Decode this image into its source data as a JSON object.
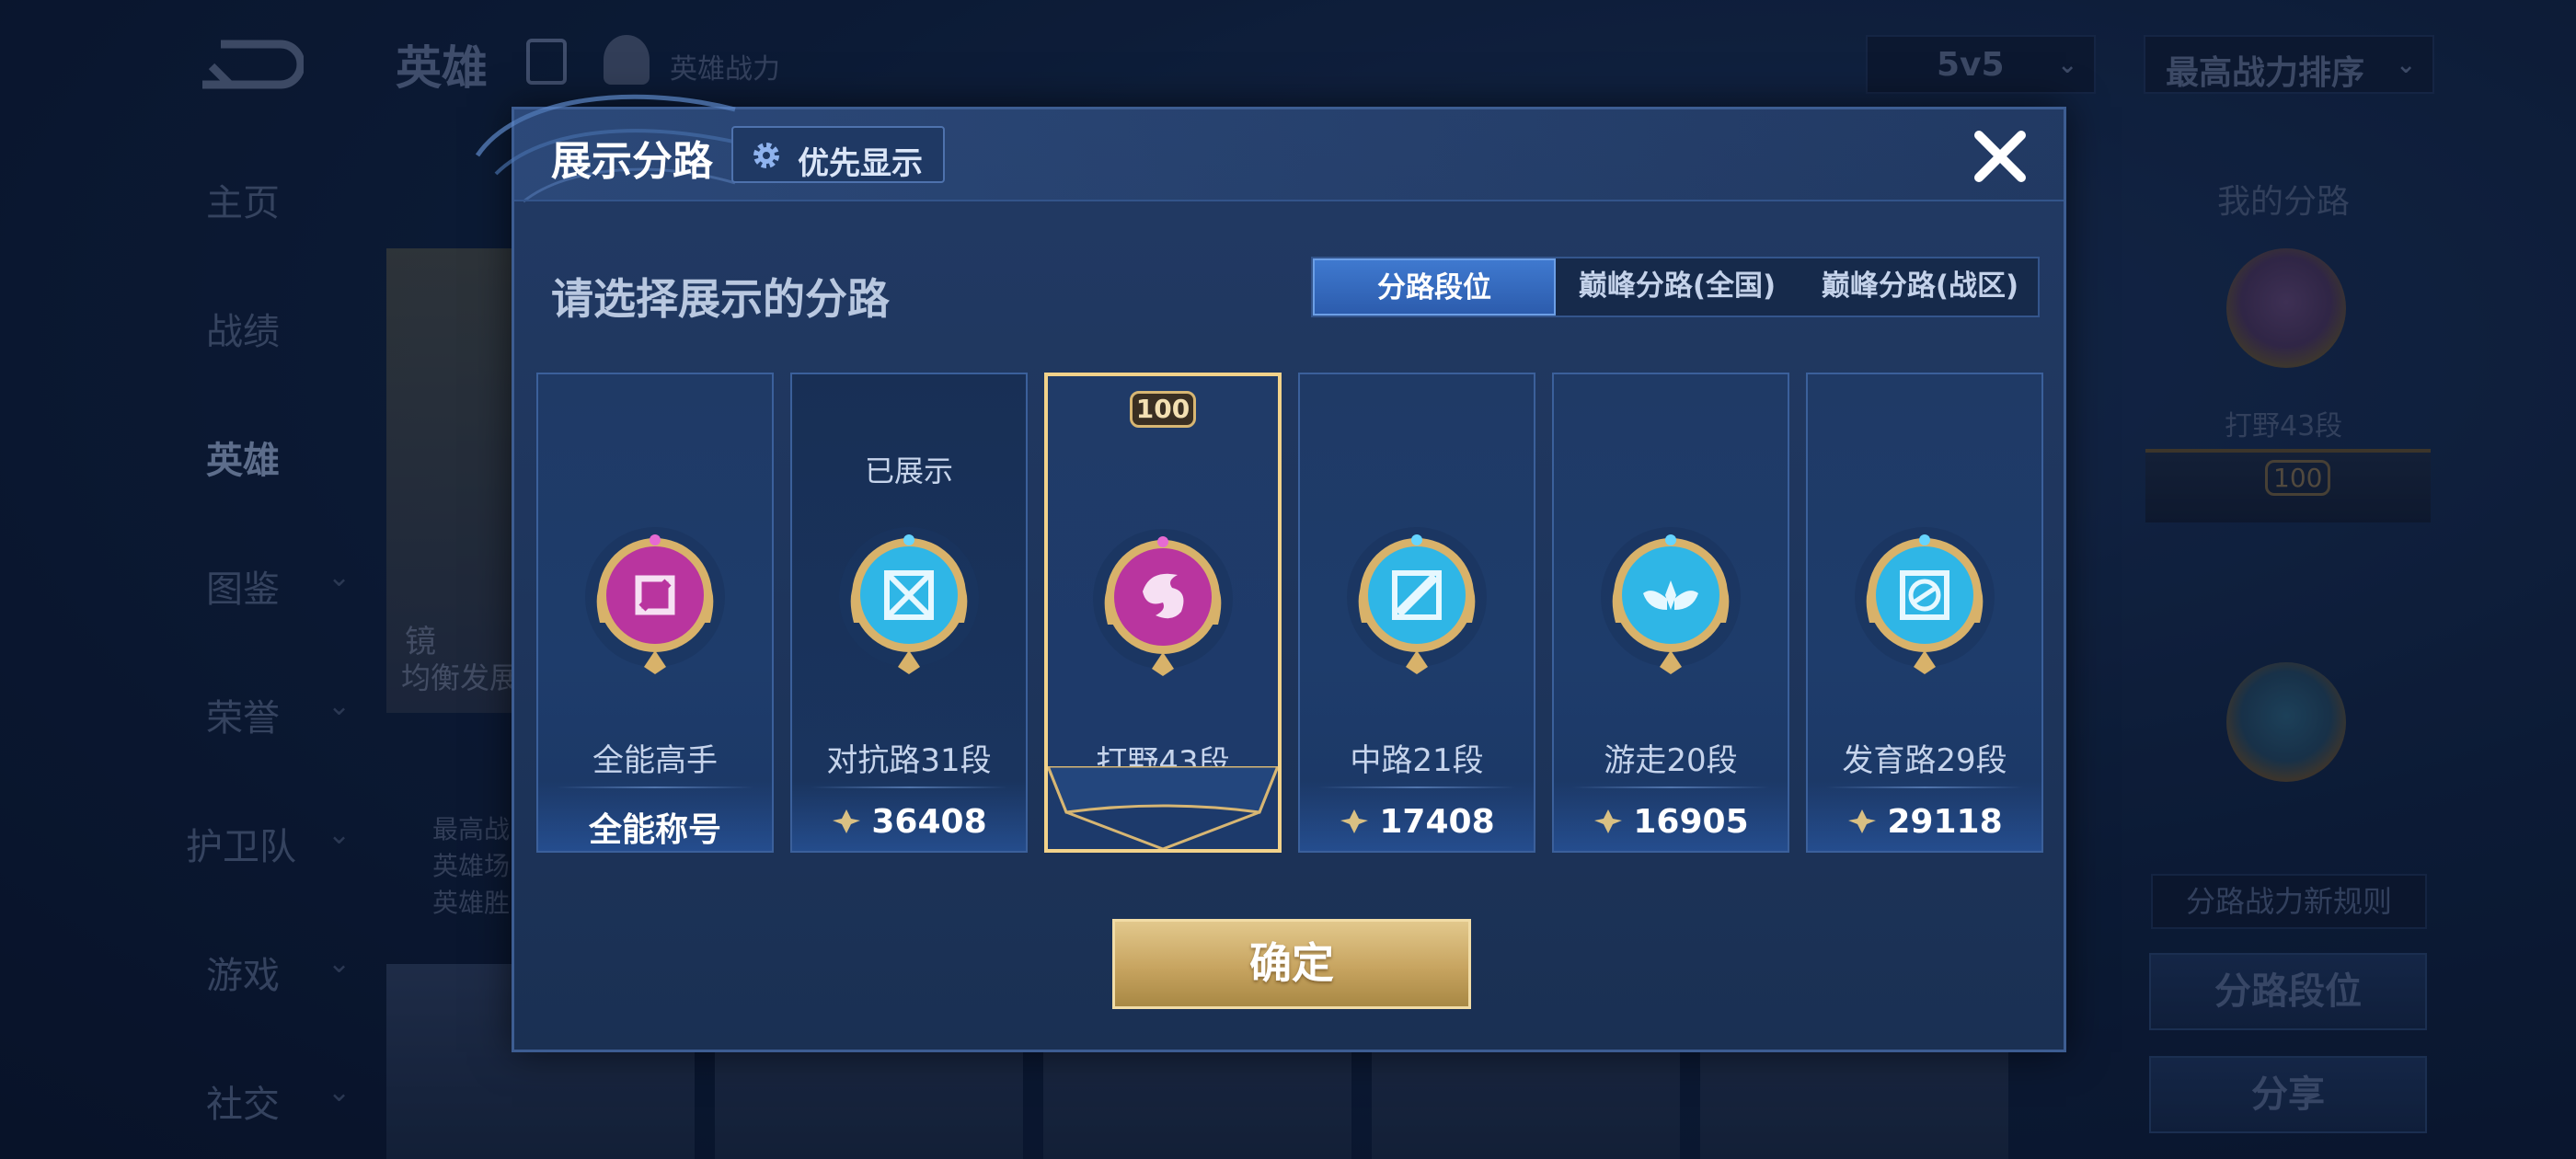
{
  "topbar": {
    "title": "英雄",
    "hero_power_link": "英雄战力",
    "mode_select": "5v5",
    "sort_select": "最高战力排序"
  },
  "sidebar": {
    "items": [
      {
        "label": "主页"
      },
      {
        "label": "战绩"
      },
      {
        "label": "英雄",
        "active": true
      },
      {
        "label": "图鉴"
      },
      {
        "label": "荣誉"
      },
      {
        "label": "护卫队"
      },
      {
        "label": "游戏"
      },
      {
        "label": "社交"
      }
    ]
  },
  "background": {
    "hero_name": "镜",
    "hero_style": "均衡发展",
    "stats": [
      "最高战",
      "英雄场",
      "英雄胜"
    ]
  },
  "right_panel": {
    "title": "我的分路",
    "lane_label": "打野43段",
    "rank_number": "100",
    "rule_label": "分路战力新规则",
    "lane_rank_button": "分路段位",
    "share_button": "分享"
  },
  "dialog": {
    "title": "展示分路",
    "priority_button": "优先显示",
    "select_title": "请选择展示的分路",
    "tabs": [
      "分路段位",
      "巅峰分路(全国)",
      "巅峰分路(战区)"
    ],
    "active_tab": "分路段位",
    "confirm_button": "确定",
    "lanes": [
      {
        "name": "全能高手",
        "footer": "全能称号",
        "icon": "all-round-badge-icon",
        "color": "#b9359f"
      },
      {
        "name": "对抗路31段",
        "power": "36408",
        "displayed_label": "已展示",
        "icon": "clash-lane-badge-icon",
        "color": "#2fb6e6"
      },
      {
        "name": "打野43段",
        "rank_number": "100",
        "selected": true,
        "icon": "jungle-badge-icon",
        "color": "#b9359f"
      },
      {
        "name": "中路21段",
        "power": "17408",
        "icon": "mid-lane-badge-icon",
        "color": "#2fb6e6"
      },
      {
        "name": "游走20段",
        "power": "16905",
        "icon": "roam-badge-icon",
        "color": "#2fb6e6"
      },
      {
        "name": "发育路29段",
        "power": "29118",
        "icon": "farm-lane-badge-icon",
        "color": "#2fb6e6"
      }
    ]
  },
  "colors": {
    "accent_gold": "#e2c88c",
    "selected_border": "#f2d28a",
    "tab_active": "#2c5cad",
    "purple_badge": "#b9359f",
    "blue_badge": "#2fb6e6"
  }
}
